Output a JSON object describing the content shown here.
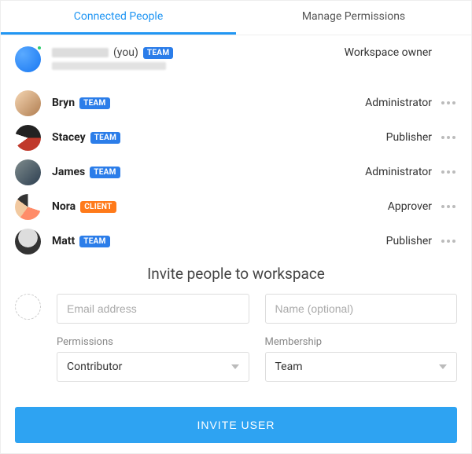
{
  "tabs": {
    "connected": "Connected People",
    "manage": "Manage Permissions"
  },
  "people": [
    {
      "name_redacted": true,
      "you_suffix": "(you)",
      "badge": "TEAM",
      "badge_type": "team",
      "role": "Workspace owner",
      "menu": false,
      "email_redacted": true
    },
    {
      "name": "Bryn",
      "badge": "TEAM",
      "badge_type": "team",
      "role": "Administrator",
      "menu": true
    },
    {
      "name": "Stacey",
      "badge": "TEAM",
      "badge_type": "team",
      "role": "Publisher",
      "menu": true
    },
    {
      "name": "James",
      "badge": "TEAM",
      "badge_type": "team",
      "role": "Administrator",
      "menu": true
    },
    {
      "name": "Nora",
      "badge": "CLIENT",
      "badge_type": "client",
      "role": "Approver",
      "menu": true
    },
    {
      "name": "Matt",
      "badge": "TEAM",
      "badge_type": "team",
      "role": "Publisher",
      "menu": true
    }
  ],
  "invite": {
    "title": "Invite people to workspace",
    "email_placeholder": "Email address",
    "name_placeholder": "Name (optional)",
    "permissions_label": "Permissions",
    "permissions_value": "Contributor",
    "membership_label": "Membership",
    "membership_value": "Team",
    "button": "INVITE USER"
  }
}
